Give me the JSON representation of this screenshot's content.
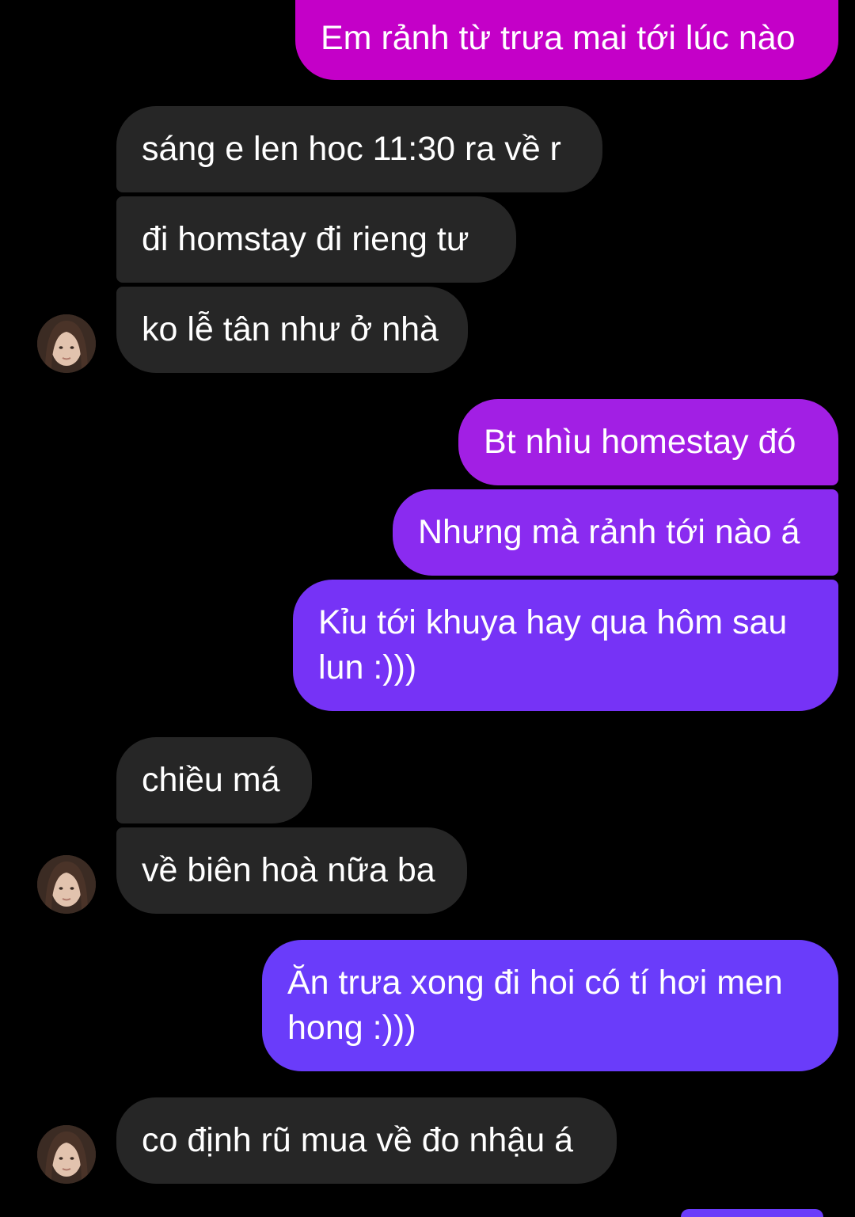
{
  "messages": [
    {
      "side": "out",
      "text": "Em rảnh từ trưa mai tới lúc nào"
    },
    {
      "side": "in",
      "text": "sáng e len hoc 11:30 ra về r"
    },
    {
      "side": "in",
      "text": "đi homstay đi rieng tư"
    },
    {
      "side": "in",
      "text": "ko lễ tân như ở nhà"
    },
    {
      "side": "out",
      "text": "Bt nhìu homestay đó"
    },
    {
      "side": "out",
      "text": "Nhưng mà rảnh tới nào á"
    },
    {
      "side": "out",
      "text": "Kỉu tới khuya hay qua hôm sau lun :)))"
    },
    {
      "side": "in",
      "text": "chiều má"
    },
    {
      "side": "in",
      "text": "về biên hoà nữa ba"
    },
    {
      "side": "out",
      "text": "Ăn trưa xong đi hoi có tí hơi men hong :)))"
    },
    {
      "side": "in",
      "text": "co định rũ mua về đo nhậu á"
    }
  ],
  "colors": {
    "background": "#000000",
    "incoming_bubble": "#262626",
    "outgoing_gradient_top": "#c400c8",
    "outgoing_gradient_mid": "#9b24ea",
    "outgoing_gradient_bottom": "#6a3cfa",
    "text": "#ffffff"
  },
  "icons": [
    "contact-avatar-icon"
  ]
}
